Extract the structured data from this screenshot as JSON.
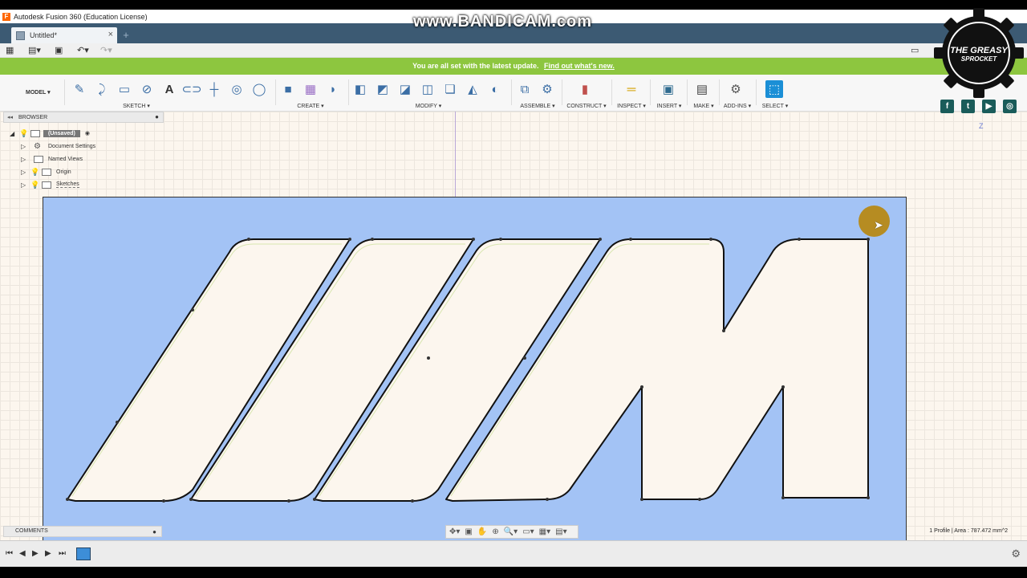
{
  "window": {
    "title": "Autodesk Fusion 360 (Education License)"
  },
  "tabs": [
    {
      "label": "Untitled*"
    }
  ],
  "notification": {
    "text": "You are all set with the latest update.",
    "link": "Find out what's new."
  },
  "workspace": {
    "label": "MODEL ▾"
  },
  "ribbon": {
    "groups": [
      {
        "label": "SKETCH ▾"
      },
      {
        "label": "CREATE ▾"
      },
      {
        "label": "MODIFY ▾"
      },
      {
        "label": "ASSEMBLE ▾"
      },
      {
        "label": "CONSTRUCT ▾"
      },
      {
        "label": "INSPECT ▾"
      },
      {
        "label": "INSERT ▾"
      },
      {
        "label": "MAKE ▾"
      },
      {
        "label": "ADD-INS ▾"
      },
      {
        "label": "SELECT ▾"
      }
    ]
  },
  "browser": {
    "header": "BROWSER",
    "root": "(Unsaved)",
    "items": [
      {
        "label": "Document Settings"
      },
      {
        "label": "Named Views"
      },
      {
        "label": "Origin"
      },
      {
        "label": "Sketches"
      }
    ]
  },
  "comments": {
    "label": "COMMENTS"
  },
  "status": {
    "profile": "1 Profile | Area : 787.472 mm^2"
  },
  "watermark": {
    "text": "www.BANDICAM.com"
  },
  "logo": {
    "line1": "THE GREASY",
    "line2": "SPROCKET"
  },
  "viewcube": {
    "axis": "Z"
  },
  "social": [
    {
      "icon": "facebook-icon"
    },
    {
      "icon": "twitter-icon"
    },
    {
      "icon": "youtube-icon"
    },
    {
      "icon": "instagram-icon"
    }
  ],
  "colors": {
    "sketch_fill": "#a3c3f5",
    "notify_bg": "#8dc63f",
    "tab_bar": "#3c5a73",
    "canvas": "#fcf6ee"
  }
}
